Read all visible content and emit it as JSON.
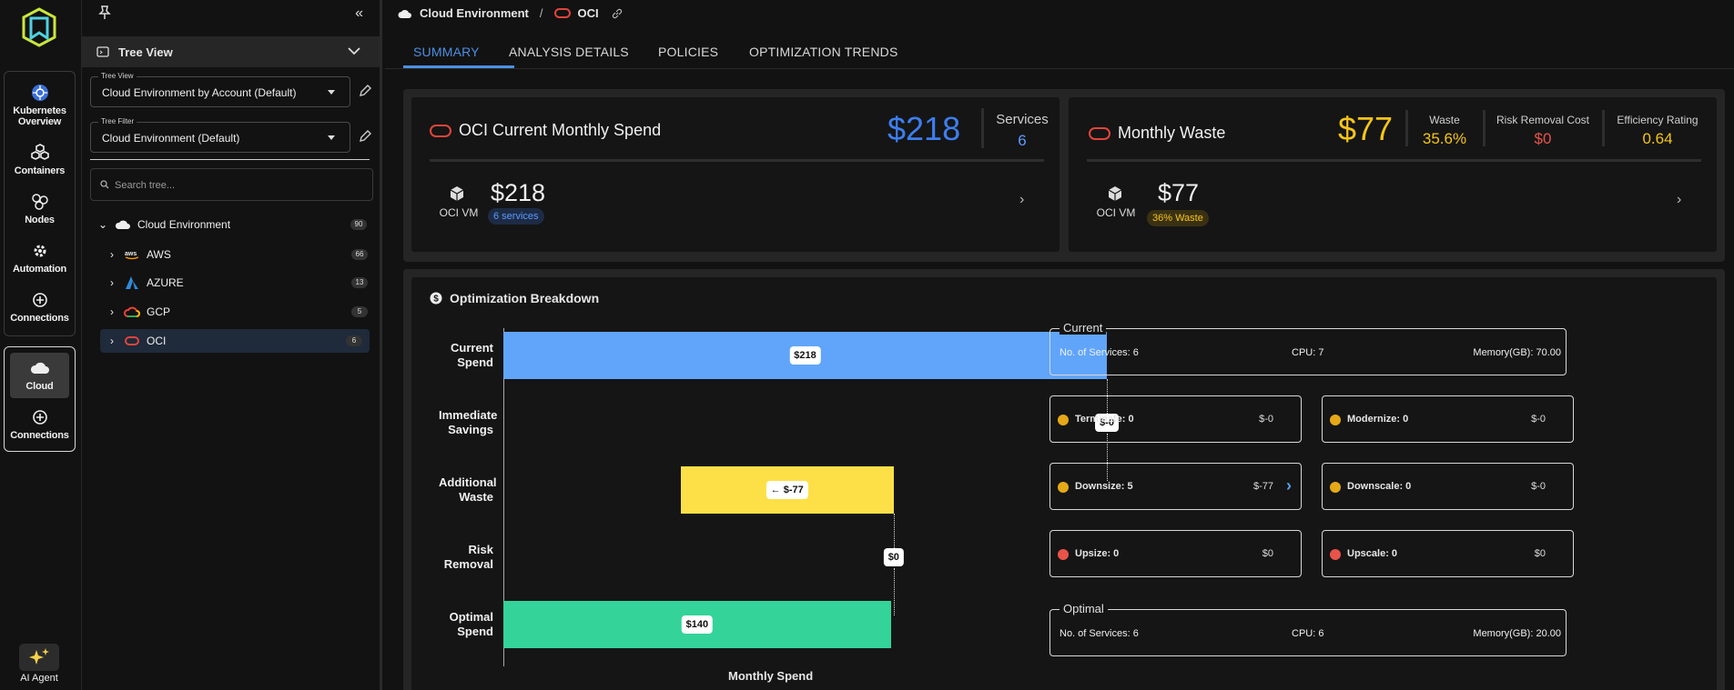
{
  "rail": {
    "items": [
      {
        "label": "Kubernetes Overview",
        "icon": "kubernetes-icon"
      },
      {
        "label": "Containers",
        "icon": "containers-icon"
      },
      {
        "label": "Nodes",
        "icon": "nodes-icon"
      },
      {
        "label": "Automation",
        "icon": "gear-icon"
      },
      {
        "label": "Connections",
        "icon": "plus-circle-icon"
      }
    ],
    "cloud_items": [
      {
        "label": "Cloud",
        "icon": "cloud-icon"
      },
      {
        "label": "Connections",
        "icon": "plus-circle-icon"
      }
    ],
    "ai_agent": "AI Agent"
  },
  "tree": {
    "header": "Tree View",
    "tree_view": {
      "label": "Tree View",
      "value": "Cloud Environment by Account (Default)"
    },
    "tree_filter": {
      "label": "Tree Filter",
      "value": "Cloud Environment (Default)"
    },
    "search_placeholder": "Search tree...",
    "root": {
      "label": "Cloud Environment",
      "count": "90"
    },
    "children": [
      {
        "label": "AWS",
        "count": "66"
      },
      {
        "label": "AZURE",
        "count": "13"
      },
      {
        "label": "GCP",
        "count": "5"
      },
      {
        "label": "OCI",
        "count": "6"
      }
    ]
  },
  "breadcrumb": {
    "root": "Cloud Environment",
    "sep": "/",
    "current": "OCI"
  },
  "tabs": [
    "SUMMARY",
    "ANALYSIS DETAILS",
    "POLICIES",
    "OPTIMIZATION TRENDS"
  ],
  "spend_card": {
    "title": "OCI Current Monthly Spend",
    "amount": "$218",
    "services_label": "Services",
    "services_value": "6",
    "sub_label": "OCI VM",
    "sub_amount": "$218",
    "sub_pill": "6 services"
  },
  "waste_card": {
    "title": "Monthly Waste",
    "amount": "$77",
    "waste_label": "Waste",
    "waste_value": "35.6%",
    "risk_label": "Risk Removal Cost",
    "risk_value": "$0",
    "eff_label": "Efficiency Rating",
    "eff_value": "0.64",
    "sub_label": "OCI VM",
    "sub_amount": "$77",
    "sub_pill": "36% Waste"
  },
  "breakdown": {
    "title": "Optimization Breakdown",
    "xlabel": "Monthly Spend",
    "current": {
      "legend": "Current",
      "services": "No. of Services: 6",
      "cpu": "CPU: 7",
      "memory": "Memory(GB): 70.00"
    },
    "optimal": {
      "legend": "Optimal",
      "services": "No. of Services: 6",
      "cpu": "CPU: 6",
      "memory": "Memory(GB): 20.00"
    },
    "actions": [
      {
        "name": "Terminate: 0",
        "amount": "$-0",
        "kind": "down"
      },
      {
        "name": "Modernize: 0",
        "amount": "$-0",
        "kind": "down"
      },
      {
        "name": "Downsize: 5",
        "amount": "$-77",
        "kind": "down"
      },
      {
        "name": "Downscale: 0",
        "amount": "$-0",
        "kind": "down"
      },
      {
        "name": "Upsize: 0",
        "amount": "$0",
        "kind": "up"
      },
      {
        "name": "Upscale: 0",
        "amount": "$0",
        "kind": "up"
      }
    ]
  },
  "chart_data": {
    "type": "bar",
    "categories": [
      "Current Spend",
      "Immediate Savings",
      "Additional Waste",
      "Risk Removal",
      "Optimal Spend"
    ],
    "values": [
      218,
      0,
      -77,
      0,
      140
    ],
    "bar_starts": [
      0,
      218,
      141,
      141,
      0
    ],
    "labels": [
      "$218",
      "$-0",
      "← $-77",
      "$0",
      "$140"
    ],
    "xlabel": "Monthly Spend",
    "colors": {
      "current": "#60a5fa",
      "waste": "#fde047",
      "optimal": "#34d399"
    }
  }
}
